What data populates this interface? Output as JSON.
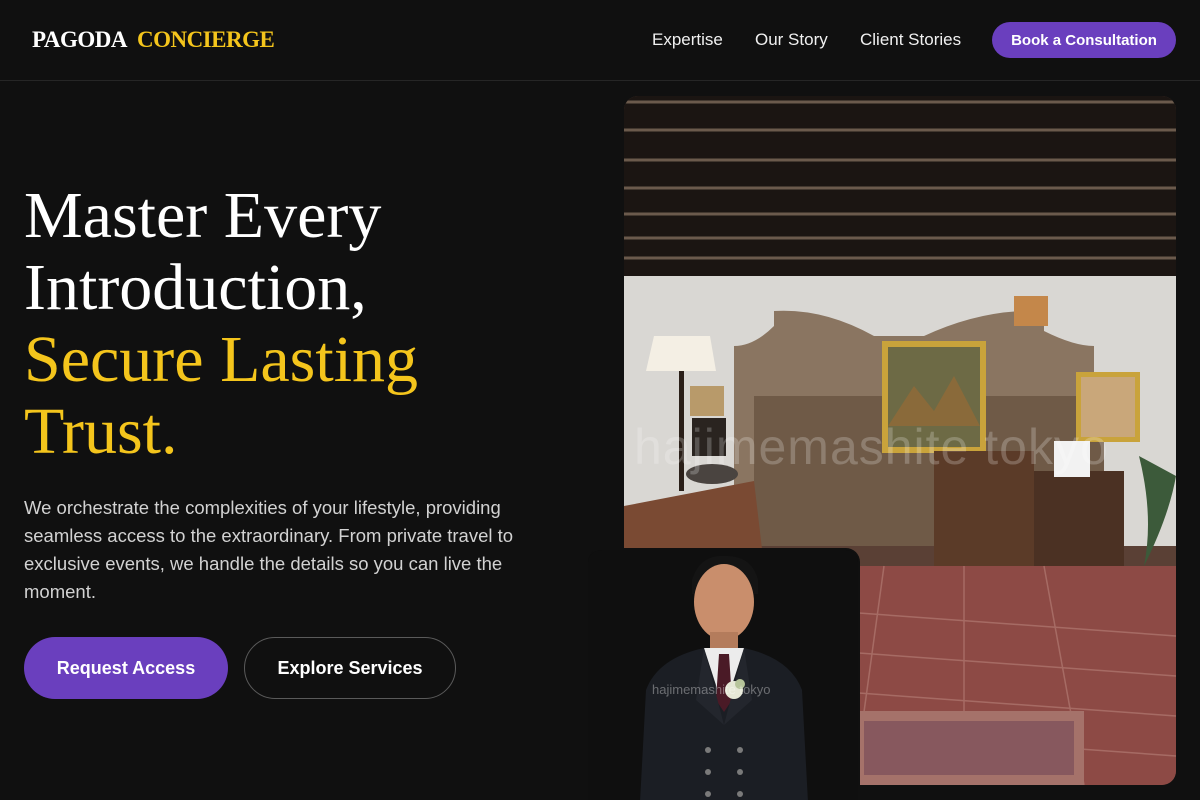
{
  "brand": {
    "name_part1": "PAGODA",
    "name_part2": "CONCIERGE"
  },
  "nav": {
    "items": [
      {
        "label": "Expertise"
      },
      {
        "label": "Our Story"
      },
      {
        "label": "Client Stories"
      }
    ],
    "cta_label": "Book a Consultation"
  },
  "hero": {
    "headline_line1": "Master Every",
    "headline_line2": "Introduction,",
    "headline_line3": "Secure Lasting",
    "headline_line4": "Trust.",
    "description": "We orchestrate the complexities of your lifestyle, providing seamless access to the extraordinary. From private travel to exclusive events, we handle the details so you can live the moment.",
    "primary_button": "Request Access",
    "secondary_button": "Explore Services"
  },
  "images": {
    "lobby_watermark": "hajimemashite tokyo",
    "portrait_watermark": "hajimemashite tokyo"
  },
  "colors": {
    "background": "#101010",
    "accent_gold": "#f4c51c",
    "accent_purple": "#6a3fbe",
    "text_muted": "#d2d2d2"
  }
}
